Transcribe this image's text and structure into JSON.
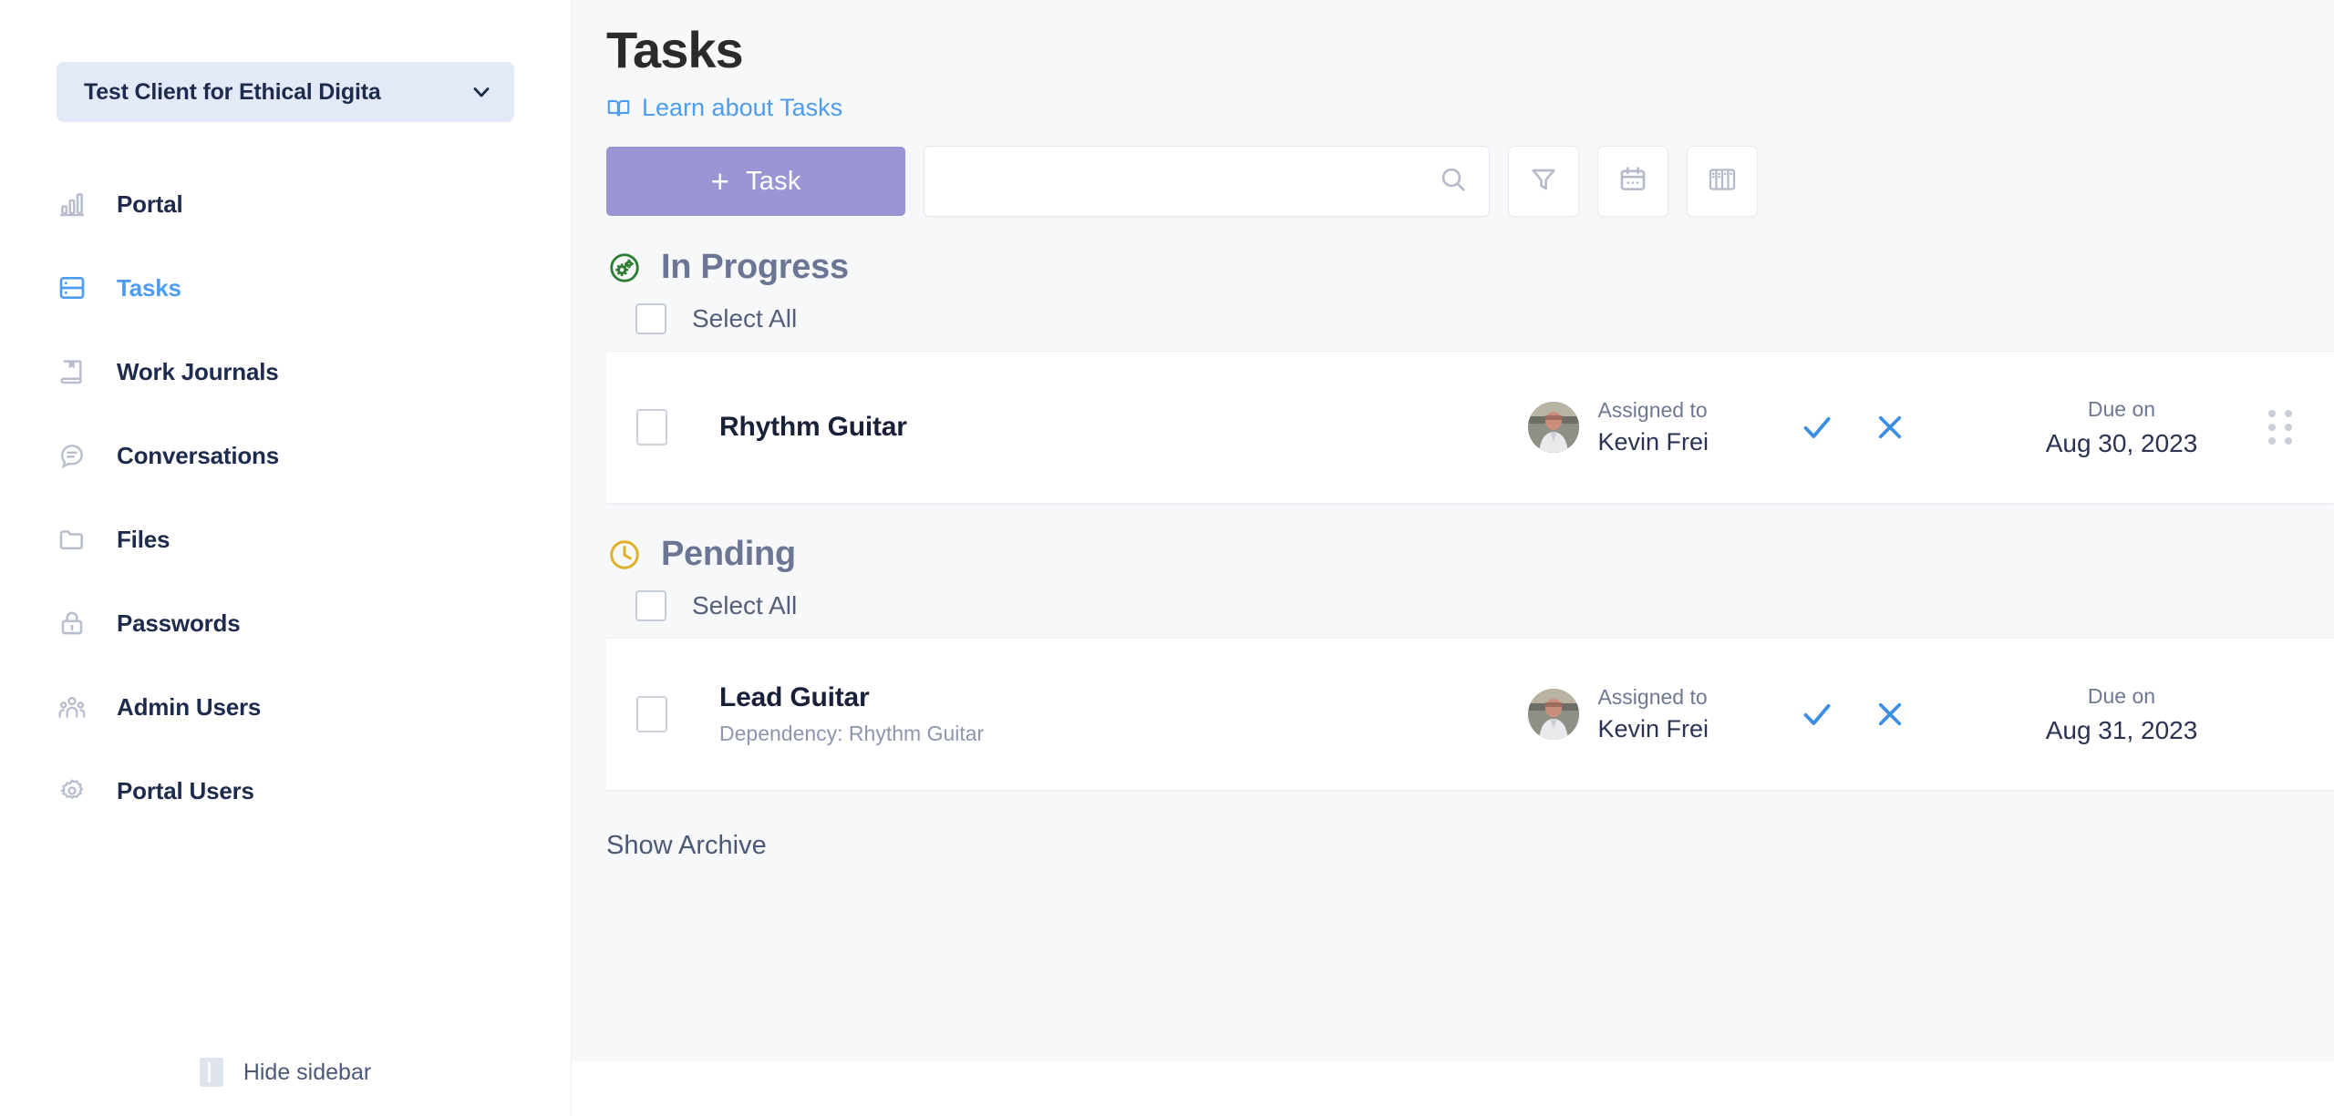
{
  "sidebar": {
    "client_selector": {
      "label": "Test Client for Ethical Digita",
      "icon": "chevron-down-icon"
    },
    "items": [
      {
        "label": "Portal",
        "icon": "bar-chart-icon",
        "active": false
      },
      {
        "label": "Tasks",
        "icon": "tasks-list-icon",
        "active": true
      },
      {
        "label": "Work Journals",
        "icon": "journal-book-icon",
        "active": false
      },
      {
        "label": "Conversations",
        "icon": "chat-bubble-icon",
        "active": false
      },
      {
        "label": "Files",
        "icon": "folder-icon",
        "active": false
      },
      {
        "label": "Passwords",
        "icon": "lock-icon",
        "active": false
      },
      {
        "label": "Admin Users",
        "icon": "users-icon",
        "active": false
      },
      {
        "label": "Portal Users",
        "icon": "gear-icon",
        "active": false
      }
    ],
    "hide_sidebar_label": "Hide sidebar"
  },
  "header": {
    "title": "Tasks",
    "learn_link": "Learn about Tasks",
    "learn_icon": "book-icon"
  },
  "toolbar": {
    "add_task_label": "Task",
    "add_task_plus": "+",
    "add_task_color": "#9a95d3",
    "search_value": "",
    "search_placeholder": "",
    "search_icon": "search-icon",
    "filter_icon": "funnel-filter-icon",
    "calendar_icon": "calendar-icon",
    "board_icon": "board-columns-icon"
  },
  "sections": [
    {
      "title": "In Progress",
      "icon": "in-progress-gears-icon",
      "icon_color": "#2f7d32",
      "select_all_label": "Select All",
      "tasks": [
        {
          "title": "Rhythm Guitar",
          "dependency": "",
          "assigned_label": "Assigned to",
          "assigned_name": "Kevin Frei",
          "due_label": "Due on",
          "due_date": "Aug 30, 2023",
          "approve_icon": "check-icon",
          "reject_icon": "x-icon",
          "drag_icon": "drag-handle-icon",
          "has_drag_handle": true
        }
      ]
    },
    {
      "title": "Pending",
      "icon": "clock-icon",
      "icon_color": "#e0b02a",
      "select_all_label": "Select All",
      "tasks": [
        {
          "title": "Lead Guitar",
          "dependency": "Dependency: Rhythm Guitar",
          "assigned_label": "Assigned to",
          "assigned_name": "Kevin Frei",
          "due_label": "Due on",
          "due_date": "Aug 31, 2023",
          "approve_icon": "check-icon",
          "reject_icon": "x-icon",
          "drag_icon": "drag-handle-icon",
          "has_drag_handle": false
        }
      ]
    }
  ],
  "footer": {
    "show_archive_label": "Show Archive"
  },
  "colors": {
    "accent_blue": "#4e9cf0",
    "purple": "#9a95d3",
    "text_dark": "#1e2b4d",
    "muted": "#6e7893"
  }
}
